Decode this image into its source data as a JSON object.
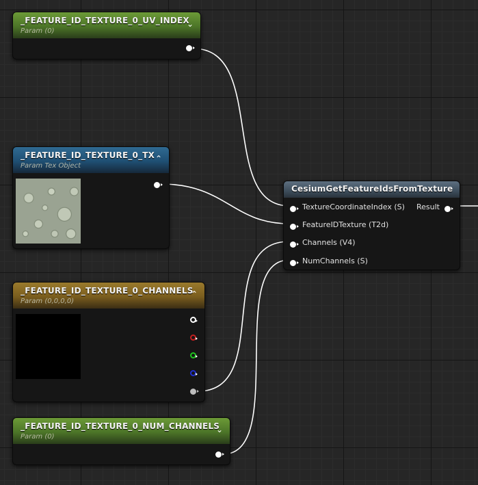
{
  "nodes": {
    "uv_index": {
      "title": "_FEATURE_ID_TEXTURE_0_UV_INDEX",
      "subtitle": "Param (0)",
      "chevron": "⌄"
    },
    "tx": {
      "title": "_FEATURE_ID_TEXTURE_0_TX",
      "subtitle": "Param Tex Object",
      "chevron": "⌃"
    },
    "channels": {
      "title": "_FEATURE_ID_TEXTURE_0_CHANNELS",
      "subtitle": "Param (0,0,0,0)",
      "chevron": "⌃"
    },
    "num_channels": {
      "title": "_FEATURE_ID_TEXTURE_0_NUM_CHANNELS",
      "subtitle": "Param (0)",
      "chevron": "⌄"
    },
    "cesium": {
      "title": "CesiumGetFeatureIdsFromTexture",
      "inputs": [
        "TextureCoordinateIndex (S)",
        "FeatureIDTexture (T2d)",
        "Channels (V4)",
        "NumChannels (S)"
      ],
      "output": "Result"
    }
  },
  "colors": {
    "pin_white": "#ffffff",
    "pin_red": "#c71f1f",
    "pin_green": "#1fc71f",
    "pin_blue": "#1f2fd0",
    "pin_grey": "#bdbdbd",
    "wire": "#ffffff"
  },
  "icons": {
    "expand": "chevron-down-icon",
    "collapse": "chevron-up-icon",
    "pin": "circle-pin-icon"
  }
}
